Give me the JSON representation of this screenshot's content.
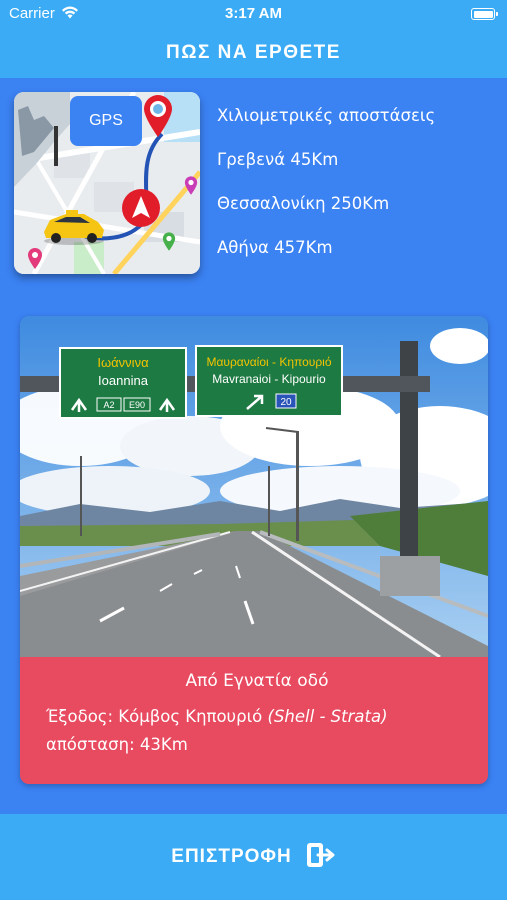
{
  "status_bar": {
    "carrier": "Carrier",
    "time": "3:17 AM",
    "battery_level": 1.0
  },
  "header": {
    "title": "ΠΩΣ ΝΑ ΕΡΘΕΤΕ"
  },
  "map_card": {
    "gps_label": "GPS",
    "icons": [
      "gps-pin-icon",
      "navigation-arrow-icon",
      "taxi-icon",
      "map-marker-icon"
    ]
  },
  "distances": {
    "heading": "Χιλιομετρικές αποστάσεις",
    "items": [
      "Γρεβενά 45Km",
      "Θεσσαλονίκη 250Km",
      "Αθήνα 457Km"
    ]
  },
  "road_card": {
    "sign_left": {
      "line1": "Ιωάννινα",
      "line2": "Ioannina",
      "tag1": "A2",
      "tag2": "E90"
    },
    "sign_right": {
      "line1": "Μαυραναίοι - Κηπουριό",
      "line2": "Mavranaioi - Kipourio",
      "tag": "20"
    },
    "caption_title": "Από Εγνατία οδό",
    "caption_exit": "Έξοδος: Κόμβος Κηπουριό",
    "caption_exit_note": "(Shell - Strata)",
    "caption_distance": "απόσταση: 43Km"
  },
  "bottom_bar": {
    "back_label": "ΕΠΙΣΤΡΟΦΗ",
    "back_icon": "exit-icon"
  },
  "colors": {
    "background": "#3b82f3",
    "bars": "#3aabf4",
    "caption": "#e84a5f",
    "sign_green": "#1e7a43"
  }
}
